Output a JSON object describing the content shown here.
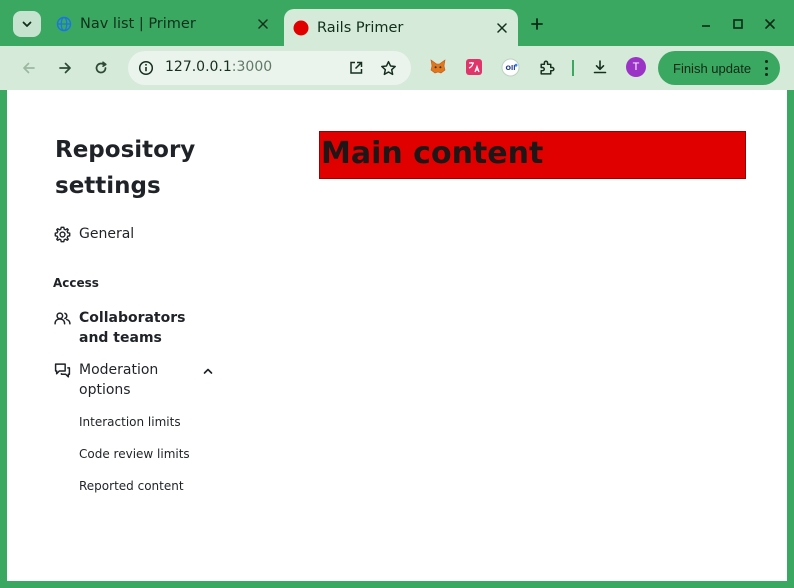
{
  "browser": {
    "tabs": [
      {
        "title": "Nav list | Primer",
        "active": false,
        "favicon": "globe-icon"
      },
      {
        "title": "Rails Primer",
        "active": true,
        "favicon": "red-circle-icon"
      }
    ],
    "url_host": "127.0.0.1",
    "url_port": ":3000",
    "profile_initial": "T",
    "finish_update_label": "Finish update",
    "colors": {
      "frame": "#3aa860",
      "toolbar": "#d5ead9",
      "avatar": "#9b33c6"
    }
  },
  "page": {
    "heading": "Repository settings",
    "nav": {
      "general": "General",
      "access_heading": "Access",
      "collaborators": "Collaborators and teams",
      "moderation": "Moderation options",
      "moderation_subitems": [
        "Interaction limits",
        "Code review limits",
        "Reported content"
      ]
    },
    "main_content": "Main content",
    "colors": {
      "main_content_bg": "#e00000",
      "text": "#1f2328"
    }
  }
}
